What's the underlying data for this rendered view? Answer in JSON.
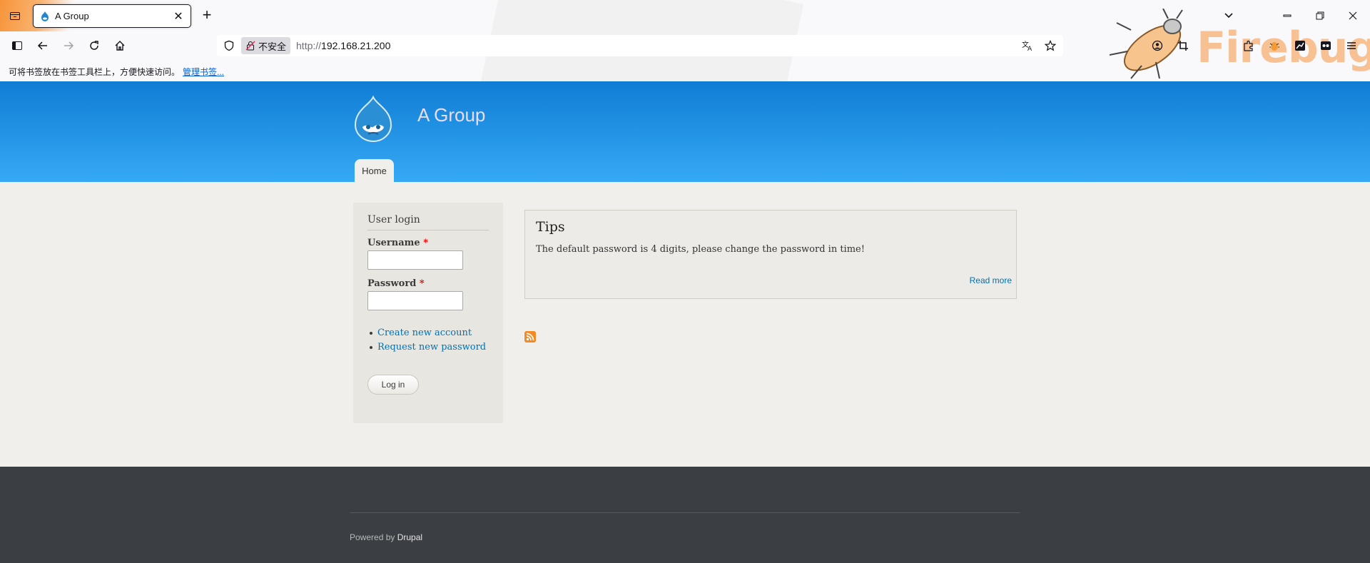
{
  "browser": {
    "tab_title": "A Group",
    "tab_close": "✕",
    "new_tab": "+",
    "url_protocol": "http://",
    "url_host": "192.168.21.200",
    "insecure_label": "不安全",
    "bookmark_hint": "可将书签放在书签工具栏上，方便快速访问。",
    "bookmark_manage": "管理书签...",
    "firebug_text": "Firebug"
  },
  "site": {
    "name": "A Group",
    "nav": [
      {
        "label": "Home"
      }
    ]
  },
  "login": {
    "title": "User login",
    "username_label": "Username",
    "password_label": "Password",
    "required_marker": "*",
    "links": [
      {
        "label": "Create new account"
      },
      {
        "label": "Request new password"
      }
    ],
    "submit_label": "Log in"
  },
  "tips": {
    "title": "Tips",
    "body": "The default password is 4 digits, please change the password in time!",
    "read_more": "Read more"
  },
  "footer": {
    "powered_by": "Powered by",
    "drupal": "Drupal"
  },
  "colors": {
    "header_top": "#0f7dd4",
    "header_bottom": "#36a9f5",
    "link": "#0071b3",
    "footer_bg": "#3b3e42"
  }
}
